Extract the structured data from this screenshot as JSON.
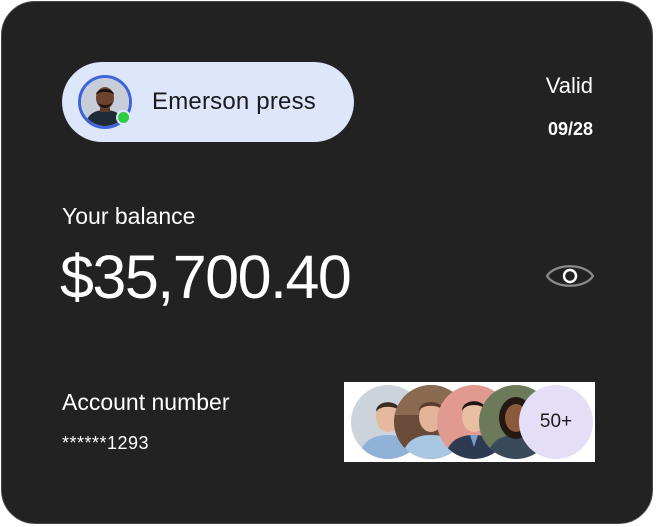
{
  "profile": {
    "name": "Emerson press",
    "avatar_icon": "user-avatar",
    "status": "online",
    "status_color": "#2ecc40"
  },
  "validity": {
    "label": "Valid",
    "date": "09/28"
  },
  "balance": {
    "label": "Your balance",
    "amount": "$35,700.40",
    "toggle_icon": "eye-icon"
  },
  "account": {
    "label": "Account number",
    "number": "******1293"
  },
  "members": {
    "avatars": [
      "member-avatar",
      "member-avatar",
      "member-avatar",
      "member-avatar"
    ],
    "more_label": "50+"
  },
  "colors": {
    "card_background": "#222222",
    "pill_background": "#dde6fb",
    "avatar_ring": "#3f63d8",
    "more_badge": "#e4dff6"
  }
}
